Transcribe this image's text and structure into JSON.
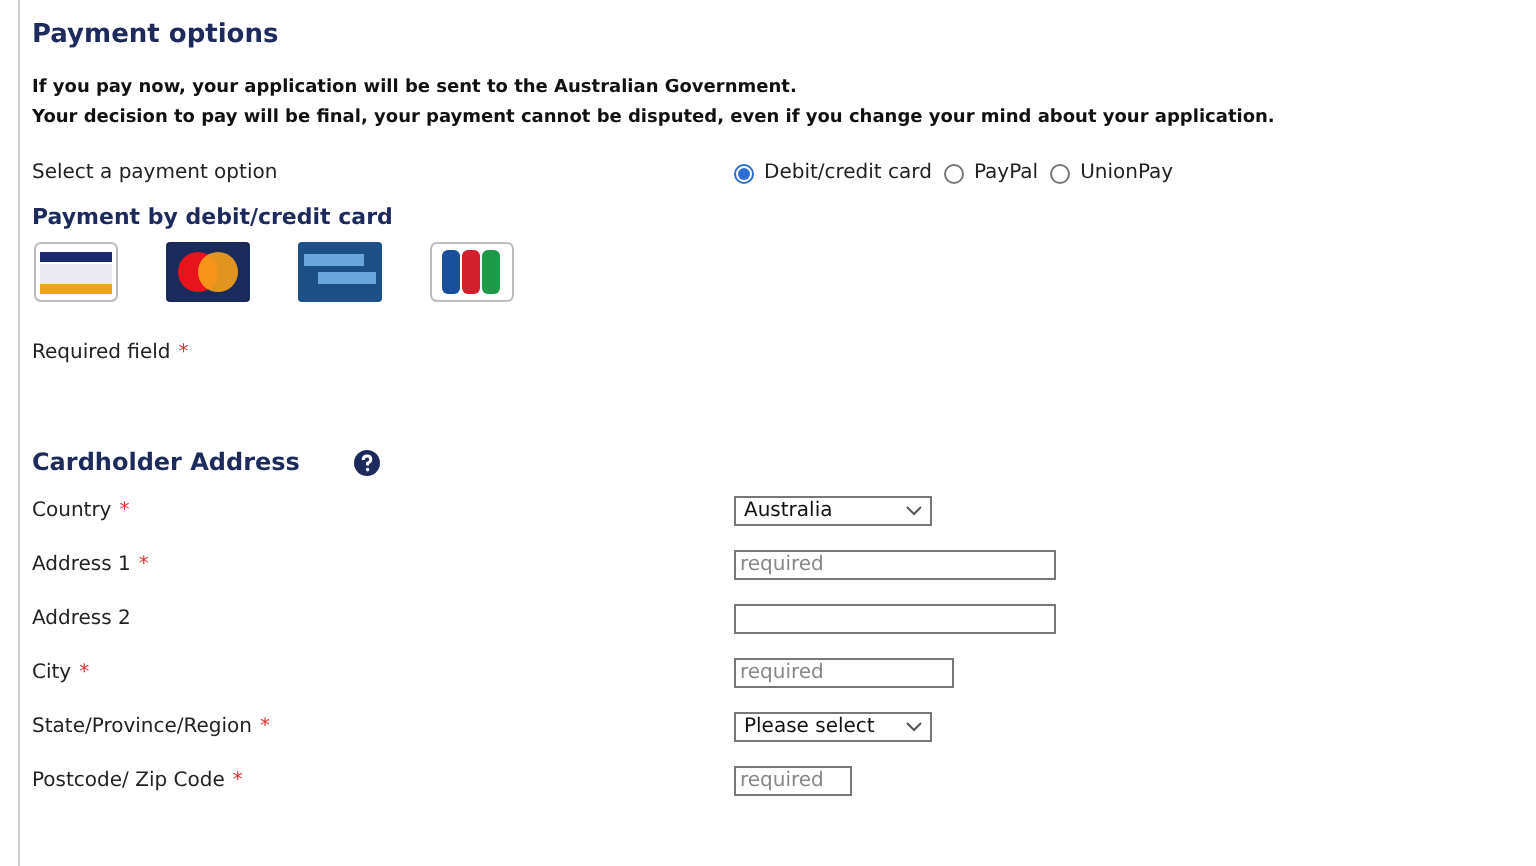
{
  "title": "Payment options",
  "notice": [
    "If you pay now, your application will be sent to the Australian Government.",
    "Your decision to pay will be final, your payment cannot be disputed, even if you change your mind about your application."
  ],
  "payment_option": {
    "label": "Select a payment option",
    "options": [
      {
        "label": "Debit/credit card",
        "selected": true
      },
      {
        "label": "PayPal",
        "selected": false
      },
      {
        "label": "UnionPay",
        "selected": false
      }
    ]
  },
  "card_section": {
    "title": "Payment by debit/credit card",
    "cards": [
      {
        "kind": "striped"
      },
      {
        "kind": "circles"
      },
      {
        "kind": "blue"
      },
      {
        "kind": "bands"
      }
    ]
  },
  "required_note": {
    "label": "Required field",
    "marker": "*"
  },
  "address": {
    "title": "Cardholder Address",
    "fields": [
      {
        "label": "Country",
        "marker": "*",
        "kind": "select",
        "value": "Australia"
      },
      {
        "label": "Address 1",
        "marker": "*",
        "kind": "input",
        "placeholder": "required"
      },
      {
        "label": "Address 2",
        "kind": "input"
      },
      {
        "label": "City",
        "marker": "*",
        "kind": "input",
        "placeholder": "required"
      },
      {
        "label": "State/Province/Region",
        "marker": "*",
        "kind": "select",
        "value": "Please select"
      },
      {
        "label": "Postcode/ Zip Code",
        "marker": "*",
        "kind": "input",
        "placeholder": "required"
      }
    ]
  }
}
